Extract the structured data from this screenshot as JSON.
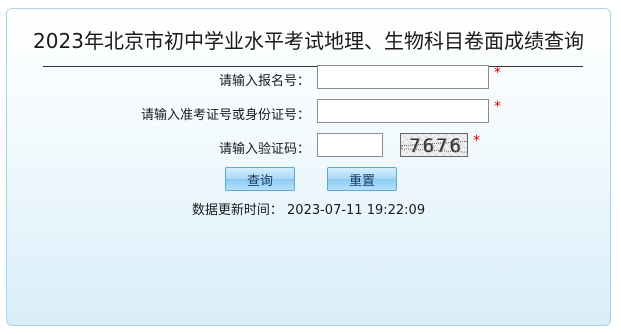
{
  "page": {
    "title": "2023年北京市初中学业水平考试地理、生物科目卷面成绩查询"
  },
  "form": {
    "registration_label": "请输入报名号：",
    "registration_value": "",
    "id_label": "请输入准考证号或身份证号：",
    "id_value": "",
    "captcha_label": "请输入验证码：",
    "captcha_value": "",
    "captcha_image_text": "7676",
    "required_mark": "*"
  },
  "buttons": {
    "query_label": "查询",
    "reset_label": "重置"
  },
  "update_info": {
    "label": "数据更新时间：",
    "timestamp": "2023-07-11 19:22:09"
  },
  "colors": {
    "required_star": "#e00000",
    "panel_border": "#a9d4e8",
    "button_text": "#1a3e66"
  }
}
